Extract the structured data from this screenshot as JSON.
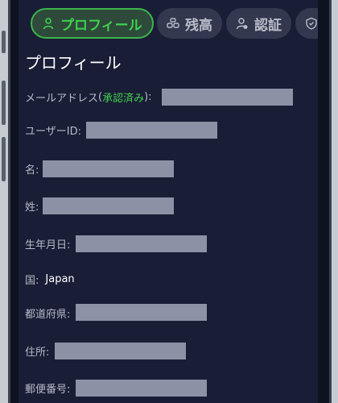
{
  "tabs": [
    {
      "label": "プロフィール",
      "icon": "person-icon",
      "active": true
    },
    {
      "label": "残高",
      "icon": "coins-icon",
      "active": false
    },
    {
      "label": "認証",
      "icon": "user-check-icon",
      "active": false
    },
    {
      "label": "",
      "icon": "shield-icon",
      "active": false
    }
  ],
  "profile": {
    "title": "プロフィール",
    "email_label": "メールアドレス",
    "email_status_open": "(",
    "email_status": "承認済み",
    "email_status_close": "):",
    "user_id_label": "ユーザーID:",
    "first_name_label": "名:",
    "last_name_label": "姓:",
    "birthdate_label": "生年月日:",
    "country_label": "国:",
    "country_value": "Japan",
    "prefecture_label": "都道府県:",
    "address_label": "住所:",
    "postal_code_label": "郵便番号:"
  },
  "colors": {
    "accent": "#3fd04d",
    "background": "#1a1d36",
    "redaction": "#8d91a6"
  }
}
